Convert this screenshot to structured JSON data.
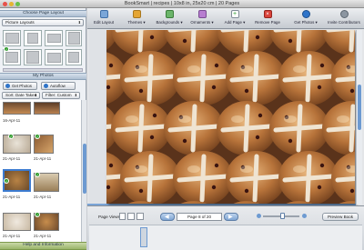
{
  "window": {
    "title": "BookSmart  |  recipes  |  10x8 in, 25x20 cm  |  20 Pages",
    "colors": {
      "close": "#e8514a",
      "minimize": "#e5b532",
      "zoom": "#67c14a"
    }
  },
  "left_panel": {
    "choose_layout_header": "Choose Page Layout",
    "layout_dropdown": "Picture Layouts",
    "my_photos_header": "My Photos",
    "get_photos_button": "Get Photos",
    "autoflow_button": "Autoflow",
    "sort_dropdown": "Sort:  Date Taken",
    "filter_dropdown": "Filter:  Custom",
    "photo_captions": [
      "16-Apr-11",
      "21-Apr-11",
      "21-Apr-11",
      "21-Apr-11",
      "21-Apr-11",
      "21-Apr-11",
      "21-Apr-11",
      "21-Apr-11"
    ],
    "help_footer": "Help and Information"
  },
  "toolbar": {
    "tools": [
      {
        "label": "Edit Layout",
        "icon": "edit-layout-icon"
      },
      {
        "label": "Themes ▾",
        "icon": "themes-icon"
      },
      {
        "label": "Backgrounds ▾",
        "icon": "backgrounds-icon"
      },
      {
        "label": "Ornaments ▾",
        "icon": "ornaments-icon"
      },
      {
        "label": "Add Page ▾",
        "icon": "add-page-icon"
      },
      {
        "label": "Remove Page",
        "icon": "remove-page-icon"
      },
      {
        "label": "Get Photos ▾",
        "icon": "get-photos-icon"
      },
      {
        "label": "Invite Contributors",
        "icon": "invite-contributors-icon"
      }
    ]
  },
  "bottom_bar": {
    "page_views_label": "Page Views",
    "page_indicator": "Page 8 of 20",
    "preview_button": "Preview Book",
    "zoom_level": 0.55
  }
}
